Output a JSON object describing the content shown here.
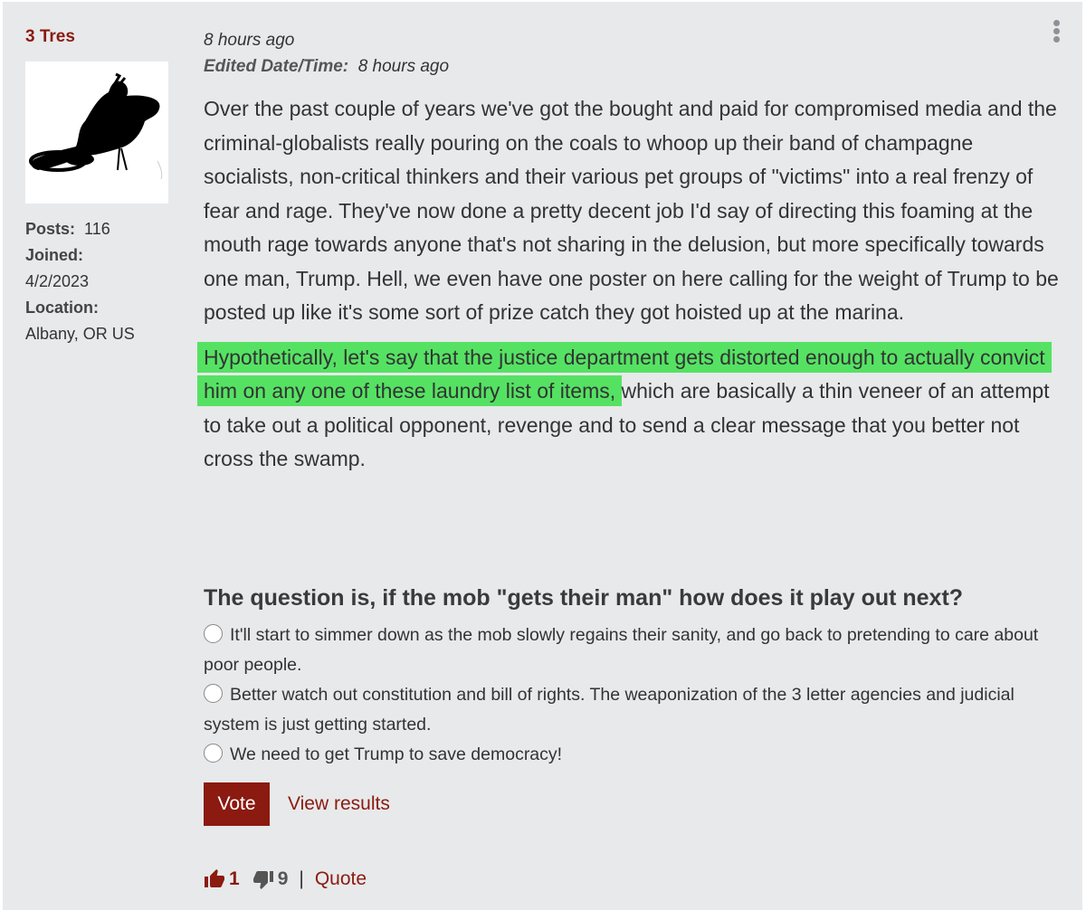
{
  "author": {
    "name": "3 Tres",
    "posts_label": "Posts:",
    "posts_value": "116",
    "joined_label": "Joined:",
    "joined_value": "4/2/2023",
    "location_label": "Location:",
    "location_value": "Albany, OR US"
  },
  "post": {
    "timestamp": "8 hours ago",
    "edited_label": "Edited Date/Time:",
    "edited_value": "8 hours ago",
    "paragraph1": "Over the past couple of years we've got the bought and paid for compromised media and the criminal-globalists really pouring on the coals to whoop up their band of champagne socialists, non-critical thinkers and their various pet groups of \"victims\" into a real frenzy of fear and rage. They've now done a pretty decent job I'd say of directing this foaming at the mouth rage towards anyone that's not sharing in the delusion, but more specifically towards one man, Trump. Hell, we even have one poster on here calling for the weight of Trump to be posted up like it's some sort of prize catch they got hoisted up at the marina.",
    "paragraph2_highlight": "Hypothetically, let's say that the justice department gets distorted enough to actually convict him on any one of these laundry list of items,",
    "paragraph2_rest": " which are basically a thin veneer of an attempt to take out a political opponent, revenge and to send a clear message that you better not cross the swamp.",
    "highlight_color": "#55e263"
  },
  "poll": {
    "question": "The question is, if the mob \"gets their man\" how does it play out next?",
    "options": [
      "It'll start to simmer down as the mob slowly regains their sanity, and go back to pretending to care about poor people.",
      "Better watch out constitution and bill of rights. The weaponization of the 3 letter agencies and judicial system is just getting started.",
      "We need to get Trump to save democracy!"
    ],
    "vote_label": "Vote",
    "view_results_label": "View results"
  },
  "footer": {
    "upvotes": "1",
    "downvotes": "9",
    "separator": "|",
    "quote_label": "Quote"
  },
  "colors": {
    "accent": "#8b1a10",
    "background": "#e8e9eb"
  },
  "icons": {
    "menu": "more-vertical-icon",
    "upvote": "thumbs-up-icon",
    "downvote": "thumbs-down-icon"
  }
}
